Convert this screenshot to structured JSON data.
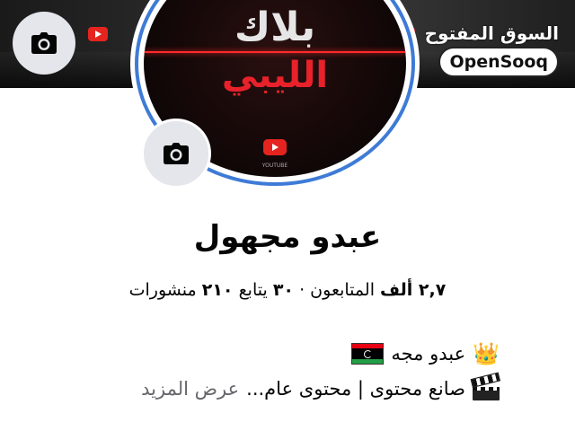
{
  "cover": {
    "watermark_arabic": "السوق المفتوح",
    "watermark_latin": "OpenSooq",
    "camera_icon": "camera-icon"
  },
  "avatar": {
    "title_line1": "بلاك",
    "title_line2": "الليبي",
    "youtube_label": "YOUTUBE",
    "camera_icon": "camera-icon",
    "ring_color": "#3e7bd6"
  },
  "profile": {
    "name": "عبدو مجهول",
    "followers_count": "٢,٧ ألف",
    "followers_label": "المتابعون",
    "following_count": "٣٠",
    "following_label": "يتابع",
    "posts_count": "٢١٠",
    "posts_label": "منشورات",
    "separator": "·"
  },
  "bio": {
    "line1_text": "عبدو مجه",
    "line1_icons": [
      "crown-icon",
      "libya-flag-icon"
    ],
    "line2_text": "صانع محتوى | محتوى عام...",
    "line2_icon": "clapperboard-icon",
    "see_more": "عرض المزيد"
  }
}
